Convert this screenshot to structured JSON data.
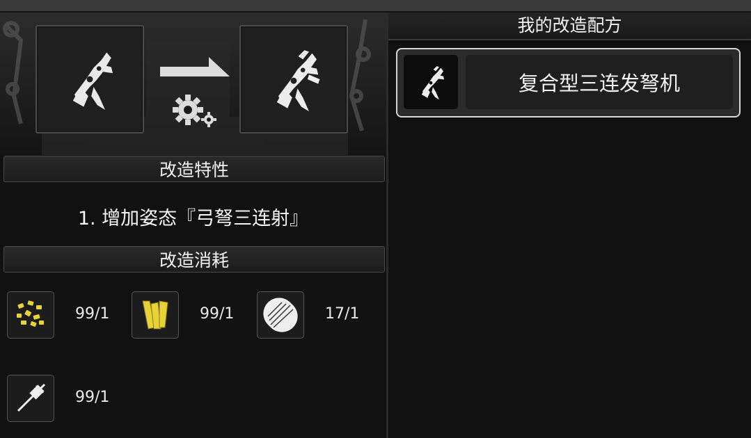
{
  "left": {
    "feature_header": "改造特性",
    "feature_text": "1. 增加姿态『弓弩三连射』",
    "cost_header": "改造消耗",
    "materials": [
      {
        "icon": "gold-nuggets-icon",
        "count": "99/1"
      },
      {
        "icon": "gold-wood-planks-icon",
        "count": "99/1"
      },
      {
        "icon": "wood-shield-icon",
        "count": "17/1"
      },
      {
        "icon": "spike-tool-icon",
        "count": "99/1"
      }
    ],
    "source_icon": "crossbow-weapon-icon",
    "result_icon": "triple-crossbow-icon"
  },
  "right": {
    "title": "我的改造配方",
    "recipes": [
      {
        "name": "复合型三连发弩机",
        "icon": "triple-crossbow-icon",
        "selected": true
      }
    ]
  },
  "colors": {
    "background": "#151515",
    "panel_border": "#4a4a4a",
    "selected_border": "#d8d8d8",
    "gold": "#e8d23a"
  }
}
